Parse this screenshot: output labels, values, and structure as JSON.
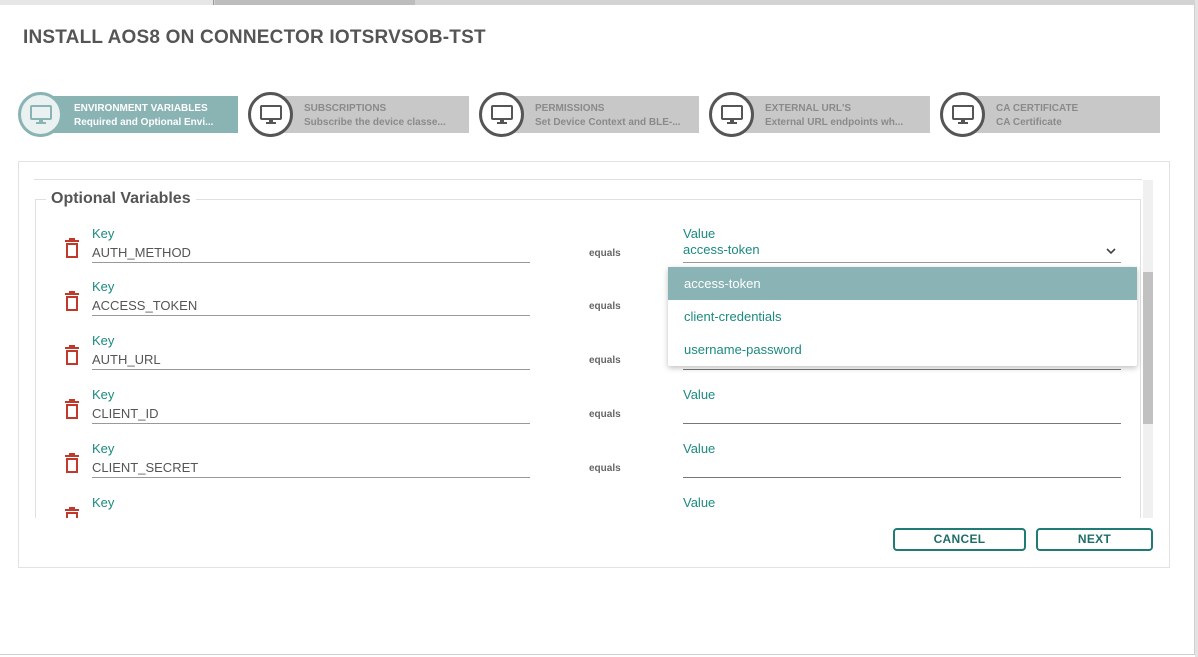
{
  "dialog": {
    "title": "INSTALL AOS8 ON CONNECTOR IOTSRVSOB-TST"
  },
  "steps": [
    {
      "title": "ENVIRONMENT VARIABLES",
      "subtitle": "Required and Optional Envi...",
      "icon": "monitor-icon",
      "active": true
    },
    {
      "title": "SUBSCRIPTIONS",
      "subtitle": "Subscribe the device classe...",
      "icon": "monitor-icon",
      "active": false
    },
    {
      "title": "PERMISSIONS",
      "subtitle": "Set Device Context and BLE-...",
      "icon": "monitor-icon",
      "active": false
    },
    {
      "title": "EXTERNAL URL'S",
      "subtitle": "External URL endpoints wh...",
      "icon": "monitor-icon",
      "active": false
    },
    {
      "title": "CA CERTIFICATE",
      "subtitle": "CA Certificate",
      "icon": "monitor-icon",
      "active": false
    }
  ],
  "section": {
    "legend": "Optional Variables"
  },
  "labels": {
    "key": "Key",
    "value": "Value",
    "equals": "equals"
  },
  "variables": [
    {
      "key": "AUTH_METHOD",
      "value": "access-token"
    },
    {
      "key": "ACCESS_TOKEN",
      "value": ""
    },
    {
      "key": "AUTH_URL",
      "value": ""
    },
    {
      "key": "CLIENT_ID",
      "value": ""
    },
    {
      "key": "CLIENT_SECRET",
      "value": ""
    },
    {
      "key": "",
      "value": ""
    }
  ],
  "dropdown": {
    "options": [
      "access-token",
      "client-credentials",
      "username-password"
    ],
    "selected": "access-token"
  },
  "buttons": {
    "cancel": "CANCEL",
    "next": "NEXT"
  },
  "colors": {
    "accent": "#1b8a7f",
    "active_step": "#8ab3b4",
    "inactive_step": "#c8c8c8",
    "delete_icon": "#c0392b"
  }
}
